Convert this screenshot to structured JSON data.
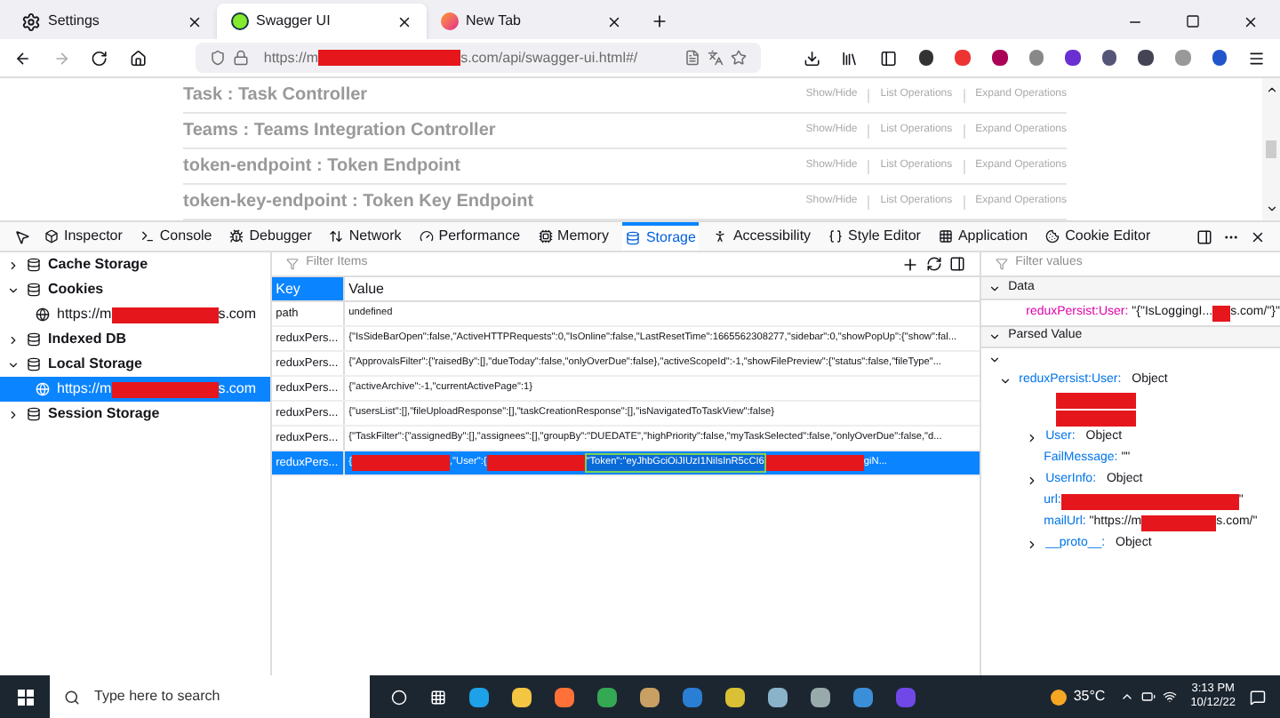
{
  "browser_tabs": [
    {
      "label": "Settings",
      "selected": false
    },
    {
      "label": "Swagger UI",
      "selected": true
    },
    {
      "label": "New Tab",
      "selected": false
    }
  ],
  "address_bar": {
    "parts": [
      {
        "kind": "text",
        "text": "https://m"
      },
      {
        "kind": "redacted"
      },
      {
        "kind": "text",
        "text": "s.com/api/swagger-ui.html#/"
      }
    ]
  },
  "swagger_sections": [
    {
      "title": "Task : Task Controller",
      "links": [
        "Show/Hide",
        "List Operations",
        "Expand Operations"
      ]
    },
    {
      "title": "Teams : Teams Integration Controller",
      "links": [
        "Show/Hide",
        "List Operations",
        "Expand Operations"
      ]
    },
    {
      "title": "token-endpoint : Token Endpoint",
      "links": [
        "Show/Hide",
        "List Operations",
        "Expand Operations"
      ]
    },
    {
      "title": "token-key-endpoint : Token Key Endpoint",
      "links": [
        "Show/Hide",
        "List Operations",
        "Expand Operations"
      ]
    }
  ],
  "devtools_tabs": [
    {
      "label": "Inspector",
      "selected": false
    },
    {
      "label": "Console",
      "selected": false
    },
    {
      "label": "Debugger",
      "selected": false
    },
    {
      "label": "Network",
      "selected": false
    },
    {
      "label": "Performance",
      "selected": false
    },
    {
      "label": "Memory",
      "selected": false
    },
    {
      "label": "Storage",
      "selected": true
    },
    {
      "label": "Accessibility",
      "selected": false
    },
    {
      "label": "Style Editor",
      "selected": false
    },
    {
      "label": "Application",
      "selected": false
    },
    {
      "label": "Cookie Editor",
      "selected": false
    }
  ],
  "storage_tree": [
    {
      "label": "Cache Storage",
      "expanded": false
    },
    {
      "label": "Cookies",
      "expanded": true,
      "children": [
        {
          "parts": [
            {
              "kind": "text",
              "text": "https://m"
            },
            {
              "kind": "redacted"
            },
            {
              "kind": "text",
              "text": "s.com"
            }
          ],
          "selected": false
        }
      ]
    },
    {
      "label": "Indexed DB",
      "expanded": false
    },
    {
      "label": "Local Storage",
      "expanded": true,
      "children": [
        {
          "parts": [
            {
              "kind": "text",
              "text": "https://m"
            },
            {
              "kind": "redacted"
            },
            {
              "kind": "text",
              "text": "s.com"
            }
          ],
          "selected": true
        }
      ]
    },
    {
      "label": "Session Storage",
      "expanded": false
    }
  ],
  "table": {
    "filter_placeholder": "Filter Items",
    "columns": [
      "Key",
      "Value"
    ],
    "rows": [
      {
        "key": "path",
        "selected": false,
        "value": [
          {
            "kind": "text",
            "text": "undefined"
          }
        ]
      },
      {
        "key": "reduxPers...",
        "selected": false,
        "value": [
          {
            "kind": "text",
            "text": "{\"IsSideBarOpen\":false,\"ActiveHTTPRequests\":0,\"IsOnline\":false,\"LastResetTime\":1665562308277,\"sidebar\":0,\"showPopUp\":{\"show\":fal..."
          }
        ]
      },
      {
        "key": "reduxPers...",
        "selected": false,
        "value": [
          {
            "kind": "text",
            "text": "{\"ApprovalsFilter\":{\"raisedBy\":[],\"dueToday\":false,\"onlyOverDue\":false},\"activeScopeId\":-1,\"showFilePreview\":{\"status\":false,\"fileType\"..."
          }
        ]
      },
      {
        "key": "reduxPers...",
        "selected": false,
        "value": [
          {
            "kind": "text",
            "text": "{\"activeArchive\":-1,\"currentActivePage\":1}"
          }
        ]
      },
      {
        "key": "reduxPers...",
        "selected": false,
        "value": [
          {
            "kind": "text",
            "text": "{\"usersList\":[],\"fileUploadResponse\":[],\"taskCreationResponse\":[],\"isNavigatedToTaskView\":false}"
          }
        ]
      },
      {
        "key": "reduxPers...",
        "selected": false,
        "value": [
          {
            "kind": "text",
            "text": "{\"TaskFilter\":{\"assignedBy\":[],\"assignees\":[],\"groupBy\":\"DUEDATE\",\"highPriority\":false,\"myTaskSelected\":false,\"onlyOverDue\":false,\"d..."
          }
        ]
      },
      {
        "key": "reduxPers...",
        "selected": true,
        "value": [
          {
            "kind": "text",
            "text": "{"
          },
          {
            "kind": "redacted"
          },
          {
            "kind": "text",
            "text": ",\"User\":{"
          },
          {
            "kind": "redacted"
          },
          {
            "kind": "highlight",
            "text": "\"Token\":\"eyJhbGciOiJIUzI1NiIsInR5cCI6"
          },
          {
            "kind": "redacted"
          },
          {
            "kind": "text",
            "text": "giN..."
          }
        ]
      }
    ]
  },
  "sidebar": {
    "filter_placeholder": "Filter values",
    "sections": [
      {
        "title": "Data",
        "expanded": true
      },
      {
        "title": "Parsed Value",
        "expanded": true
      }
    ],
    "data_line": [
      {
        "kind": "key",
        "text": "reduxPersist:User:"
      },
      {
        "kind": "text",
        "text": " \"{\"IsLoggingI..."
      },
      {
        "kind": "redacted"
      },
      {
        "kind": "text",
        "text": "s.com/\"}\""
      }
    ],
    "tree": [
      {
        "kind": "expander",
        "expanded": true
      },
      {
        "kind": "object",
        "parts": [
          {
            "kind": "key",
            "text": "reduxPersist:User:"
          },
          {
            "kind": "text",
            "text": " Object"
          }
        ],
        "expanded": true
      },
      {
        "kind": "redacted"
      },
      {
        "kind": "redacted"
      },
      {
        "kind": "object",
        "parts": [
          {
            "kind": "key",
            "text": "User:"
          },
          {
            "kind": "text",
            "text": " Object"
          }
        ],
        "expanded": false
      },
      {
        "kind": "leaf",
        "parts": [
          {
            "kind": "key",
            "text": "FailMessage:"
          },
          {
            "kind": "text",
            "text": " \"\""
          }
        ]
      },
      {
        "kind": "object",
        "parts": [
          {
            "kind": "key",
            "text": "UserInfo:"
          },
          {
            "kind": "text",
            "text": " Object"
          }
        ],
        "expanded": false
      },
      {
        "kind": "leaf",
        "parts": [
          {
            "kind": "key",
            "text": "url:"
          },
          {
            "kind": "redacted"
          },
          {
            "kind": "text",
            "text": "\""
          }
        ]
      },
      {
        "kind": "leaf",
        "parts": [
          {
            "kind": "key",
            "text": "mailUrl:"
          },
          {
            "kind": "text",
            "text": " \"https://m"
          },
          {
            "kind": "redacted"
          },
          {
            "kind": "text",
            "text": "s.com/\""
          }
        ]
      },
      {
        "kind": "object",
        "parts": [
          {
            "kind": "key",
            "text": "__proto__:"
          },
          {
            "kind": "text",
            "text": " Object"
          }
        ],
        "expanded": false
      }
    ]
  },
  "taskbar": {
    "search_placeholder": "Type here to search",
    "temperature": "35°C",
    "time": "3:13 PM",
    "date": "10/12/22"
  }
}
